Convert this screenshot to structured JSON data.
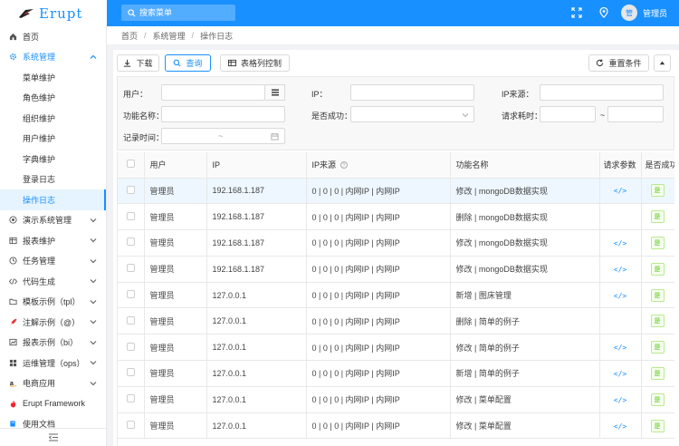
{
  "header": {
    "logo_text": "Erupt",
    "search_placeholder": "搜索菜单",
    "username": "管理员",
    "avatar_char": "管"
  },
  "sidebar": {
    "home": "首页",
    "system": {
      "label": "系统管理",
      "children": [
        "菜单维护",
        "角色维护",
        "组织维护",
        "用户维护",
        "字典维护",
        "登录日志",
        "操作日志"
      ],
      "active_index": 6
    },
    "items": [
      {
        "label": "演示系统管理",
        "icon": "target-icon",
        "chevron": true
      },
      {
        "label": "报表维护",
        "icon": "table-icon",
        "chevron": true
      },
      {
        "label": "任务管理",
        "icon": "clock-icon",
        "chevron": true
      },
      {
        "label": "代码生成",
        "icon": "code-icon",
        "chevron": true
      },
      {
        "label": "模板示例（tpl）",
        "icon": "folder-icon",
        "chevron": true
      },
      {
        "label": "注解示例（@）",
        "icon": "rocket-icon",
        "chevron": true
      },
      {
        "label": "报表示例（bi）",
        "icon": "chart-icon",
        "chevron": true
      },
      {
        "label": "运维管理（ops）",
        "icon": "grid-icon",
        "chevron": true
      },
      {
        "label": "电商应用",
        "icon": "amazon-icon",
        "chevron": true
      },
      {
        "label": "Erupt Framework",
        "icon": "flame-icon",
        "chevron": false
      },
      {
        "label": "使用文档",
        "icon": "book-icon",
        "chevron": false
      }
    ]
  },
  "breadcrumb": [
    "首页",
    "系统管理",
    "操作日志"
  ],
  "toolbar": {
    "download": "下载",
    "query": "查询",
    "columns": "表格列控制",
    "reset": "重置条件"
  },
  "filter": {
    "user_label": "用户：",
    "ip_label": "IP：",
    "ip_source_label": "IP来源：",
    "function_label": "功能名称：",
    "success_label": "是否成功：",
    "duration_label": "请求耗时：",
    "duration_sep": "~",
    "time_label": "记录时间：",
    "time_sep": "~"
  },
  "table": {
    "headers": [
      "用户",
      "IP",
      "IP来源",
      "功能名称",
      "请求参数",
      "是否成功"
    ],
    "rows": [
      {
        "user": "管理员",
        "ip": "192.168.1.187",
        "src": "0 | 0 | 0 | 内网IP | 内网IP",
        "fn": "修改 | mongoDB数据实现",
        "params": true,
        "ok": "是"
      },
      {
        "user": "管理员",
        "ip": "192.168.1.187",
        "src": "0 | 0 | 0 | 内网IP | 内网IP",
        "fn": "删除 | mongoDB数据实现",
        "params": false,
        "ok": "是"
      },
      {
        "user": "管理员",
        "ip": "192.168.1.187",
        "src": "0 | 0 | 0 | 内网IP | 内网IP",
        "fn": "修改 | mongoDB数据实现",
        "params": true,
        "ok": "是"
      },
      {
        "user": "管理员",
        "ip": "192.168.1.187",
        "src": "0 | 0 | 0 | 内网IP | 内网IP",
        "fn": "修改 | mongoDB数据实现",
        "params": true,
        "ok": "是"
      },
      {
        "user": "管理员",
        "ip": "127.0.0.1",
        "src": "0 | 0 | 0 | 内网IP | 内网IP",
        "fn": "新增 | 图床管理",
        "params": true,
        "ok": "是"
      },
      {
        "user": "管理员",
        "ip": "127.0.0.1",
        "src": "0 | 0 | 0 | 内网IP | 内网IP",
        "fn": "删除 | 简单的例子",
        "params": false,
        "ok": "是"
      },
      {
        "user": "管理员",
        "ip": "127.0.0.1",
        "src": "0 | 0 | 0 | 内网IP | 内网IP",
        "fn": "修改 | 简单的例子",
        "params": true,
        "ok": "是"
      },
      {
        "user": "管理员",
        "ip": "127.0.0.1",
        "src": "0 | 0 | 0 | 内网IP | 内网IP",
        "fn": "新增 | 简单的例子",
        "params": true,
        "ok": "是"
      },
      {
        "user": "管理员",
        "ip": "127.0.0.1",
        "src": "0 | 0 | 0 | 内网IP | 内网IP",
        "fn": "修改 | 菜单配置",
        "params": true,
        "ok": "是"
      },
      {
        "user": "管理员",
        "ip": "127.0.0.1",
        "src": "0 | 0 | 0 | 内网IP | 内网IP",
        "fn": "修改 | 菜单配置",
        "params": true,
        "ok": "是"
      }
    ]
  },
  "colors": {
    "primary": "#1890ff",
    "success": "#52c41a"
  }
}
